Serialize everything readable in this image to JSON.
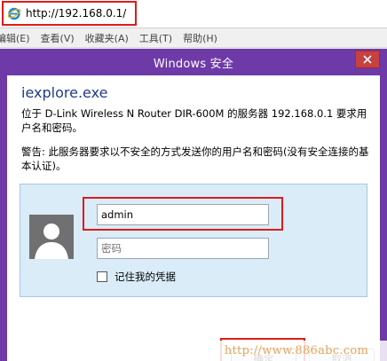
{
  "browser": {
    "url": "http://192.168.0.1/",
    "menu": [
      "编辑(E)",
      "查看(V)",
      "收藏夹(A)",
      "工具(T)",
      "帮助(H)"
    ]
  },
  "dialog": {
    "title": "Windows 安全",
    "app_name": "iexplore.exe",
    "description": "位于 D-Link Wireless N Router DIR-600M 的服务器 192.168.0.1 要求用户名和密码。",
    "warning": "警告: 此服务器要求以不安全的方式发送你的用户名和密码(没有安全连接的基本认证)。",
    "username_value": "admin",
    "password_placeholder": "密码",
    "remember_label": "记住我的凭据",
    "ok_label": "确定",
    "cancel_label": "取消"
  },
  "watermark": "http://www.886abc.com",
  "colors": {
    "titlebar": "#6e3aa8",
    "highlight": "#e01b1b",
    "panel": "#d9ecf8",
    "close": "#c64141"
  },
  "icons": [
    "ie-icon",
    "close-icon",
    "user-avatar-icon"
  ]
}
